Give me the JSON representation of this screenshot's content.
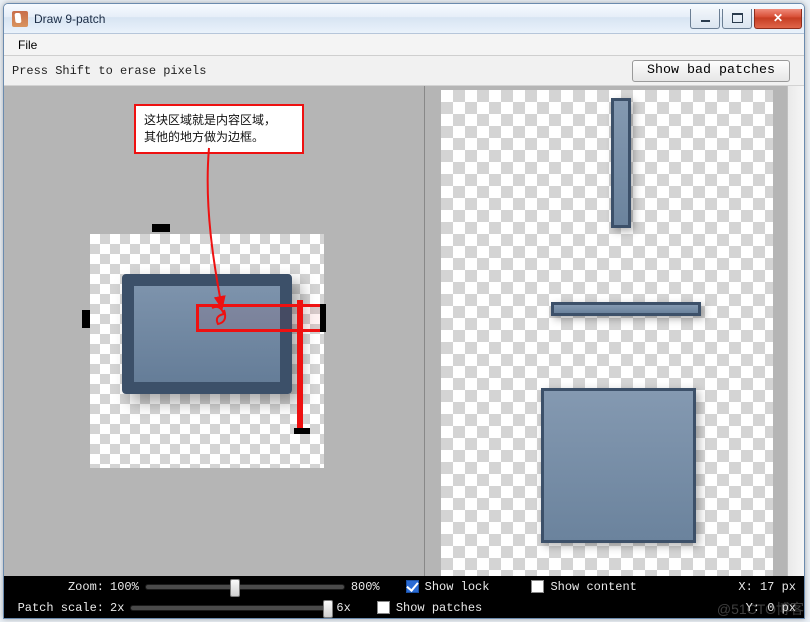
{
  "window": {
    "title": "Draw 9-patch"
  },
  "menubar": {
    "file": "File"
  },
  "toolbar": {
    "hint": "Press Shift to erase pixels",
    "show_bad_patches": "Show bad patches"
  },
  "annotation": {
    "line1": "这块区域就是内容区域，",
    "line2": "其他的地方做为边框。"
  },
  "bottom": {
    "zoom_label": "Zoom:",
    "zoom_min": "100%",
    "zoom_max": "800%",
    "show_lock": "Show lock",
    "show_content": "Show content",
    "patch_scale_label": "Patch scale:",
    "scale_min": "2x",
    "scale_max": "6x",
    "show_patches": "Show patches",
    "x_label": "X:",
    "x_value": "17",
    "y_label": "Y:",
    "y_value": "0",
    "px": "px"
  },
  "checkboxes": {
    "show_lock": true,
    "show_content": false,
    "show_patches": false
  },
  "watermark": "@51CTO博客"
}
